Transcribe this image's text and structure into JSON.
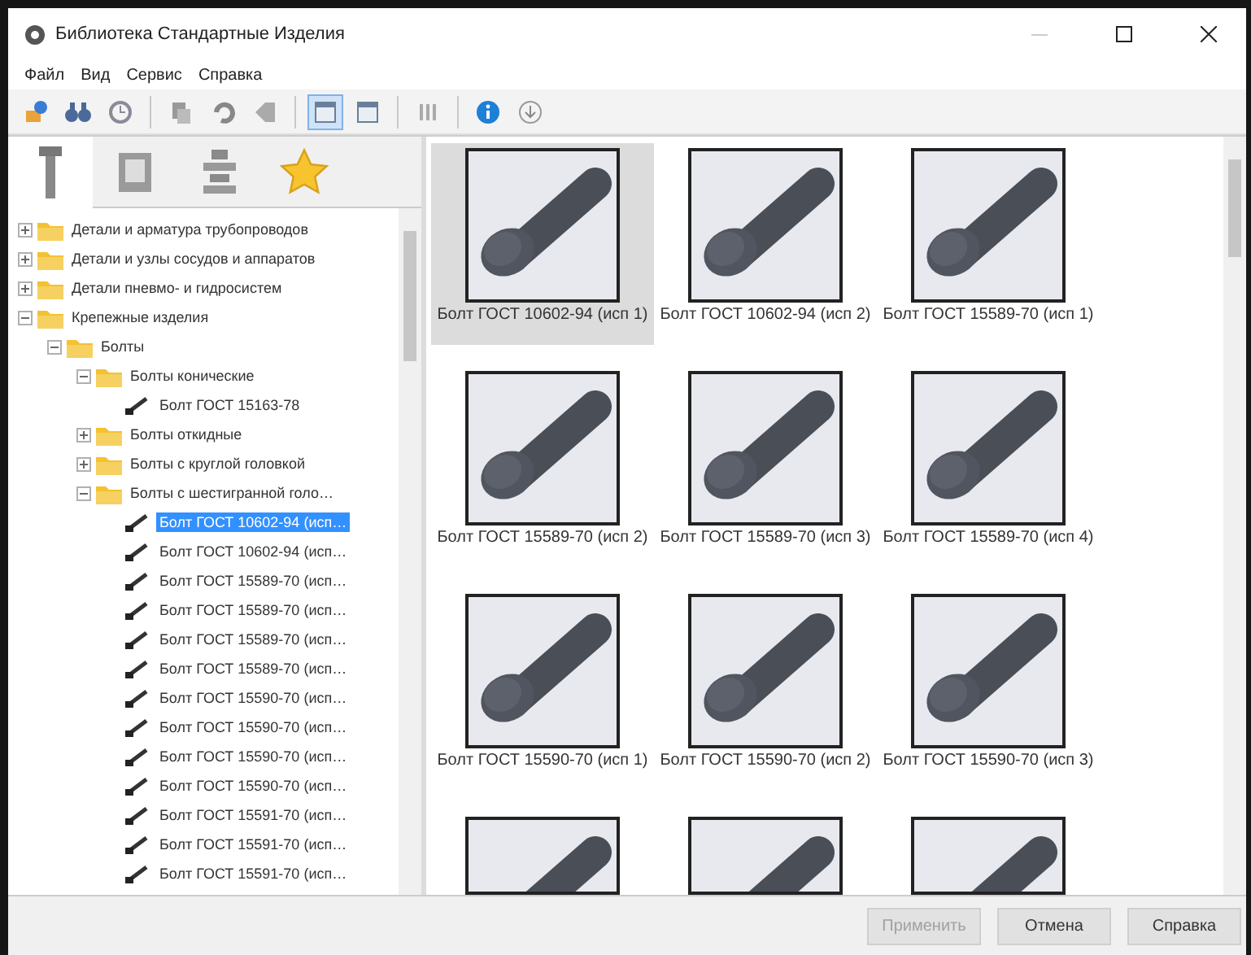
{
  "window": {
    "title": "Библиотека Стандартные Изделия"
  },
  "menu": [
    "Файл",
    "Вид",
    "Сервис",
    "Справка"
  ],
  "toolbar": [
    {
      "kind": "button",
      "selected": false
    },
    {
      "kind": "button",
      "selected": false
    },
    {
      "kind": "button",
      "selected": false
    },
    {
      "kind": "separator"
    },
    {
      "kind": "button",
      "selected": false
    },
    {
      "kind": "button",
      "selected": false
    },
    {
      "kind": "button",
      "selected": false
    },
    {
      "kind": "separator"
    },
    {
      "kind": "button",
      "selected": true
    },
    {
      "kind": "button",
      "selected": false
    },
    {
      "kind": "separator"
    },
    {
      "kind": "button",
      "selected": false
    },
    {
      "kind": "separator"
    },
    {
      "kind": "button",
      "selected": false
    },
    {
      "kind": "button",
      "selected": false
    }
  ],
  "side_tabs": [
    {
      "selected": true
    },
    {
      "selected": false
    },
    {
      "selected": false
    },
    {
      "selected": false
    }
  ],
  "tree": [
    {
      "label": "Детали и арматура трубопроводов",
      "kind": "folder",
      "expanded": false
    },
    {
      "label": "Детали и узлы сосудов и аппаратов",
      "kind": "folder",
      "expanded": false
    },
    {
      "label": "Детали пневмо- и гидросистем",
      "kind": "folder",
      "expanded": false
    },
    {
      "label": "Крепежные изделия",
      "kind": "folder",
      "expanded": true,
      "children": [
        {
          "label": "Болты",
          "kind": "folder",
          "expanded": true,
          "children": [
            {
              "label": "Болты конические",
              "kind": "folder",
              "expanded": true,
              "children": [
                {
                  "label": "Болт ГОСТ 15163-78",
                  "kind": "part",
                  "selected": false
                }
              ]
            },
            {
              "label": "Болты откидные",
              "kind": "folder",
              "expanded": false
            },
            {
              "label": "Болты с круглой головкой",
              "kind": "folder",
              "expanded": false
            },
            {
              "label": "Болты с шестигранной голо…",
              "kind": "folder",
              "expanded": true,
              "children": [
                {
                  "label": "Болт ГОСТ 10602-94 (исп…",
                  "kind": "part",
                  "selected": true
                },
                {
                  "label": "Болт ГОСТ 10602-94 (исп…",
                  "kind": "part",
                  "selected": false
                },
                {
                  "label": "Болт ГОСТ 15589-70 (исп…",
                  "kind": "part",
                  "selected": false
                },
                {
                  "label": "Болт ГОСТ 15589-70 (исп…",
                  "kind": "part",
                  "selected": false
                },
                {
                  "label": "Болт ГОСТ 15589-70 (исп…",
                  "kind": "part",
                  "selected": false
                },
                {
                  "label": "Болт ГОСТ 15589-70 (исп…",
                  "kind": "part",
                  "selected": false
                },
                {
                  "label": "Болт ГОСТ 15590-70 (исп…",
                  "kind": "part",
                  "selected": false
                },
                {
                  "label": "Болт ГОСТ 15590-70 (исп…",
                  "kind": "part",
                  "selected": false
                },
                {
                  "label": "Болт ГОСТ 15590-70 (исп…",
                  "kind": "part",
                  "selected": false
                },
                {
                  "label": "Болт ГОСТ 15590-70 (исп…",
                  "kind": "part",
                  "selected": false
                },
                {
                  "label": "Болт ГОСТ 15591-70 (исп…",
                  "kind": "part",
                  "selected": false
                },
                {
                  "label": "Болт ГОСТ 15591-70 (исп…",
                  "kind": "part",
                  "selected": false
                },
                {
                  "label": "Болт ГОСТ 15591-70 (исп…",
                  "kind": "part",
                  "selected": false
                }
              ]
            }
          ]
        }
      ]
    }
  ],
  "gallery": [
    {
      "label": "Болт ГОСТ 10602-94 (исп 1)",
      "selected": true
    },
    {
      "label": "Болт ГОСТ 10602-94 (исп 2)",
      "selected": false
    },
    {
      "label": "Болт ГОСТ 15589-70 (исп 1)",
      "selected": false
    },
    {
      "label": "Болт ГОСТ 15589-70 (исп 2)",
      "selected": false
    },
    {
      "label": "Болт ГОСТ 15589-70 (исп 3)",
      "selected": false
    },
    {
      "label": "Болт ГОСТ 15589-70 (исп 4)",
      "selected": false
    },
    {
      "label": "Болт ГОСТ 15590-70 (исп 1)",
      "selected": false
    },
    {
      "label": "Болт ГОСТ 15590-70 (исп 2)",
      "selected": false
    },
    {
      "label": "Болт ГОСТ 15590-70 (исп 3)",
      "selected": false
    },
    {
      "selected": false
    },
    {
      "selected": false
    },
    {
      "selected": false
    }
  ],
  "buttons": [
    {
      "label": "Применить",
      "disabled": true
    },
    {
      "label": "Отмена",
      "disabled": false
    },
    {
      "label": "Справка",
      "disabled": false
    }
  ]
}
